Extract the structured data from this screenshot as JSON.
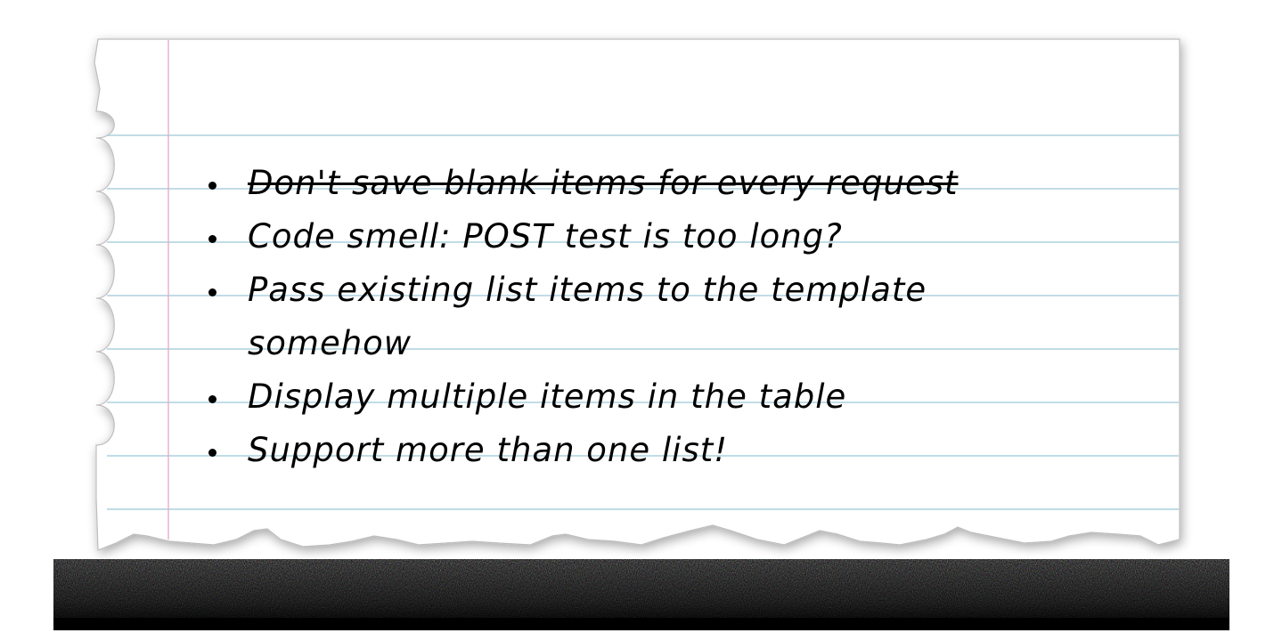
{
  "note": {
    "items": [
      {
        "text": "Don't save blank items for every request",
        "done": true
      },
      {
        "text": "Code smell: POST test is too long?",
        "done": false
      },
      {
        "text": "Pass existing list items to the template somehow",
        "done": false
      },
      {
        "text": "Display multiple items in the table",
        "done": false
      },
      {
        "text": "Support more than one list!",
        "done": false
      }
    ]
  },
  "colors": {
    "rule_line": "#9cc8d6",
    "margin_line": "#e6a8c8",
    "paper": "#ffffff",
    "ink": "#000000"
  }
}
